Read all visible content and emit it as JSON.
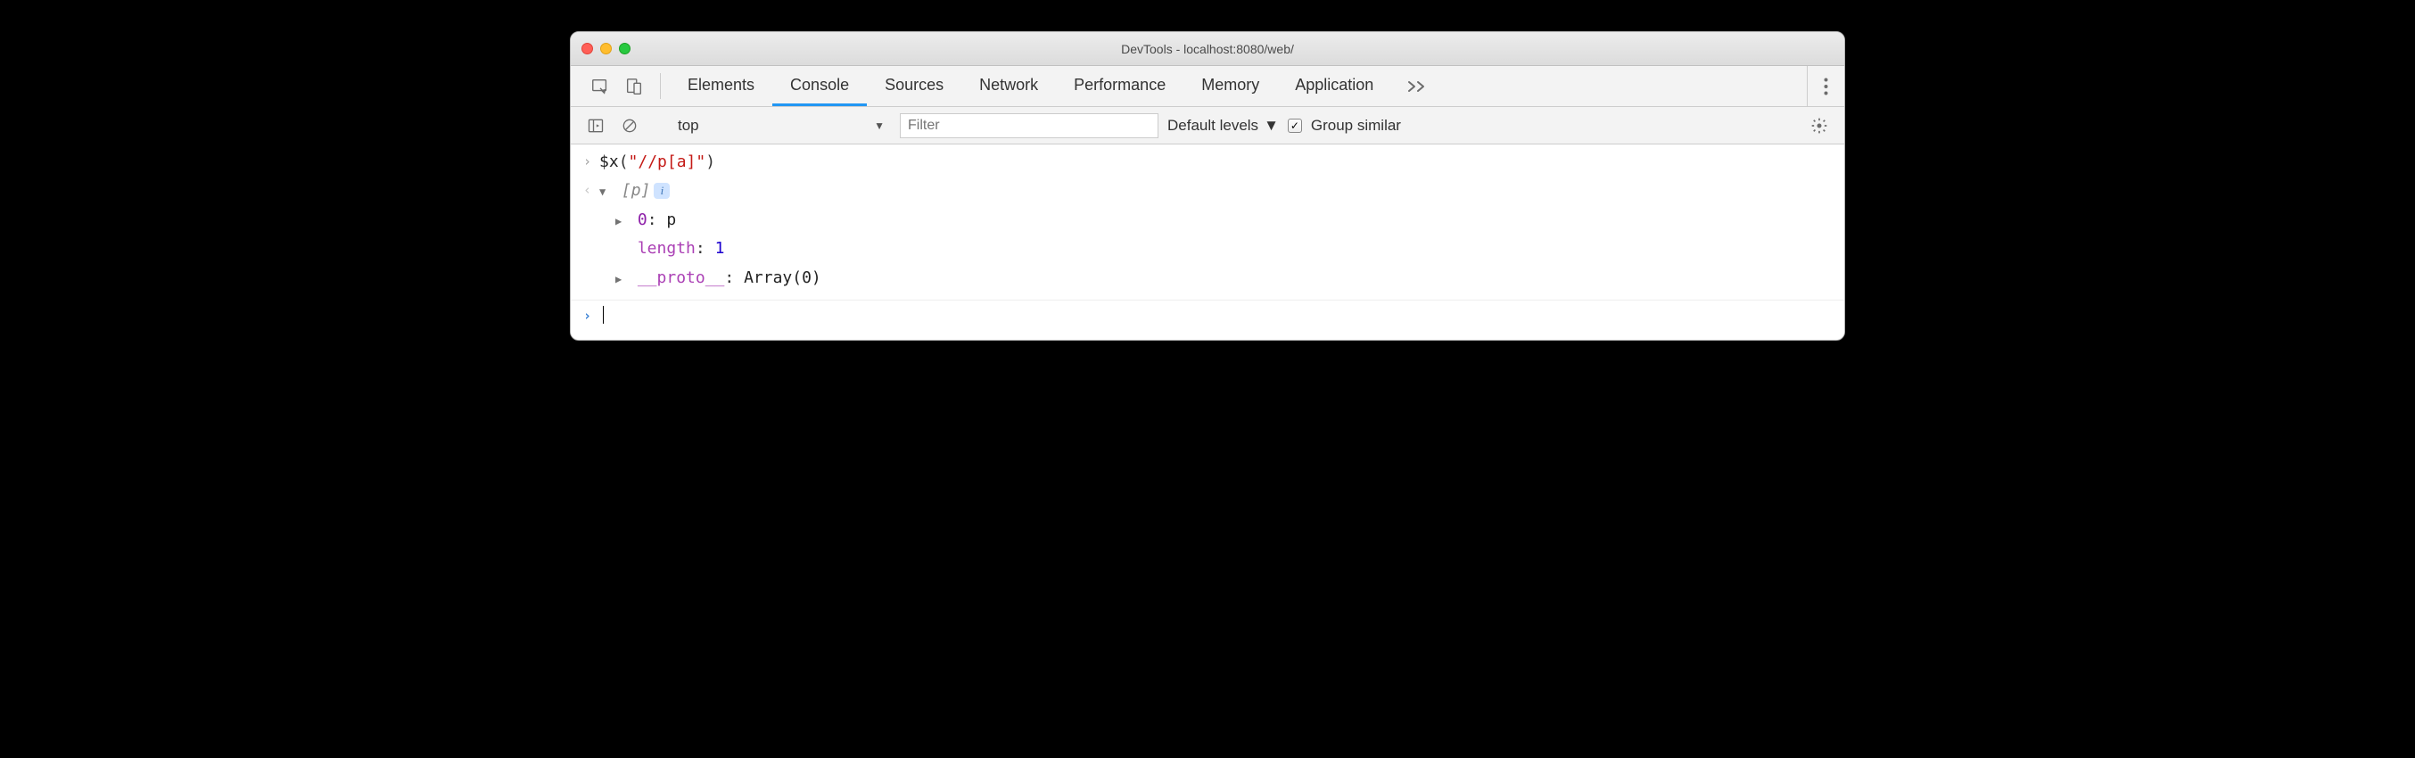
{
  "window": {
    "title": "DevTools - localhost:8080/web/"
  },
  "tabs": [
    {
      "label": "Elements"
    },
    {
      "label": "Console"
    },
    {
      "label": "Sources"
    },
    {
      "label": "Network"
    },
    {
      "label": "Performance"
    },
    {
      "label": "Memory"
    },
    {
      "label": "Application"
    }
  ],
  "active_tab_index": 1,
  "filterbar": {
    "context": "top",
    "filter_placeholder": "Filter",
    "levels_label": "Default levels",
    "group_similar_label": "Group similar",
    "group_similar_checked": true
  },
  "console": {
    "input_line": {
      "fn": "$x",
      "open": "(",
      "string": "\"//p[a]\"",
      "close": ")"
    },
    "output": {
      "summary_open": "[",
      "summary_item": "p",
      "summary_close": "]",
      "entries": [
        {
          "key": "0",
          "value": "p"
        },
        {
          "key": "length",
          "value": "1"
        },
        {
          "key": "__proto__",
          "value": "Array(0)"
        }
      ]
    }
  }
}
